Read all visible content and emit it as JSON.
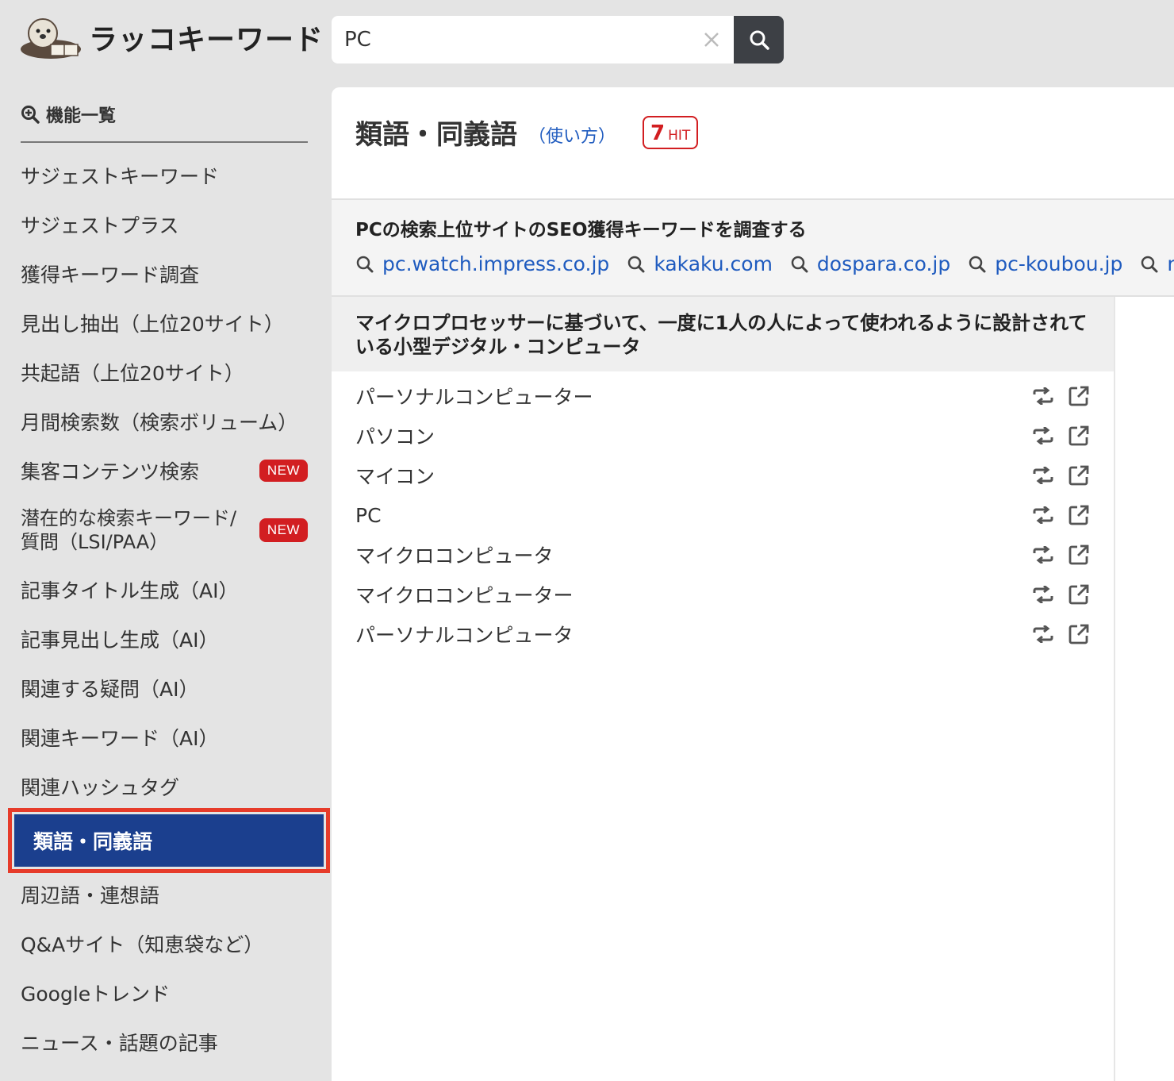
{
  "brand": {
    "name": "ラッコキーワード"
  },
  "search": {
    "value": "PC"
  },
  "sidebar": {
    "heading": "機能一覧",
    "items": [
      {
        "label": "サジェストキーワード"
      },
      {
        "label": "サジェストプラス"
      },
      {
        "label": "獲得キーワード調査"
      },
      {
        "label": "見出し抽出（上位20サイト）"
      },
      {
        "label": "共起語（上位20サイト）"
      },
      {
        "label": "月間検索数（検索ボリューム）"
      },
      {
        "label": "集客コンテンツ検索",
        "badge": "NEW"
      },
      {
        "label": "潜在的な検索キーワード/\n質問（LSI/PAA）",
        "badge": "NEW"
      },
      {
        "label": "記事タイトル生成（AI）"
      },
      {
        "label": "記事見出し生成（AI）"
      },
      {
        "label": "関連する疑問（AI）"
      },
      {
        "label": "関連キーワード（AI）"
      },
      {
        "label": "関連ハッシュタグ"
      },
      {
        "label": "類語・同義語",
        "active": true
      },
      {
        "label": "周辺語・連想語"
      },
      {
        "label": "Q&Aサイト（知恵袋など）"
      },
      {
        "label": "Googleトレンド"
      },
      {
        "label": "ニュース・話題の記事"
      }
    ]
  },
  "main": {
    "title": "類語・同義語",
    "howto": "（使い方）",
    "hit_count": "7",
    "hit_label": "HIT",
    "seo_title": "PCの検索上位サイトのSEO獲得キーワードを調査する",
    "sites": [
      "pc.watch.impress.co.jp",
      "kakaku.com",
      "dospara.co.jp",
      "pc-koubou.jp",
      "mc"
    ],
    "definition": "マイクロプロセッサーに基づいて、一度に1人の人によって使われるように設計されている小型デジタル・コンピュータ",
    "words": [
      "パーソナルコンピューター",
      "パソコン",
      "マイコン",
      "PC",
      "マイクロコンピュータ",
      "マイクロコンピューター",
      "パーソナルコンピュータ"
    ]
  },
  "colors": {
    "accent": "#1b3f8e",
    "link": "#1f5bbf",
    "badge": "#d21e21",
    "highlight": "#e63b2a"
  },
  "icons": [
    "otter-logo",
    "clear-icon",
    "search-icon",
    "magnify-plus-icon",
    "swap-icon",
    "external-link-icon"
  ]
}
